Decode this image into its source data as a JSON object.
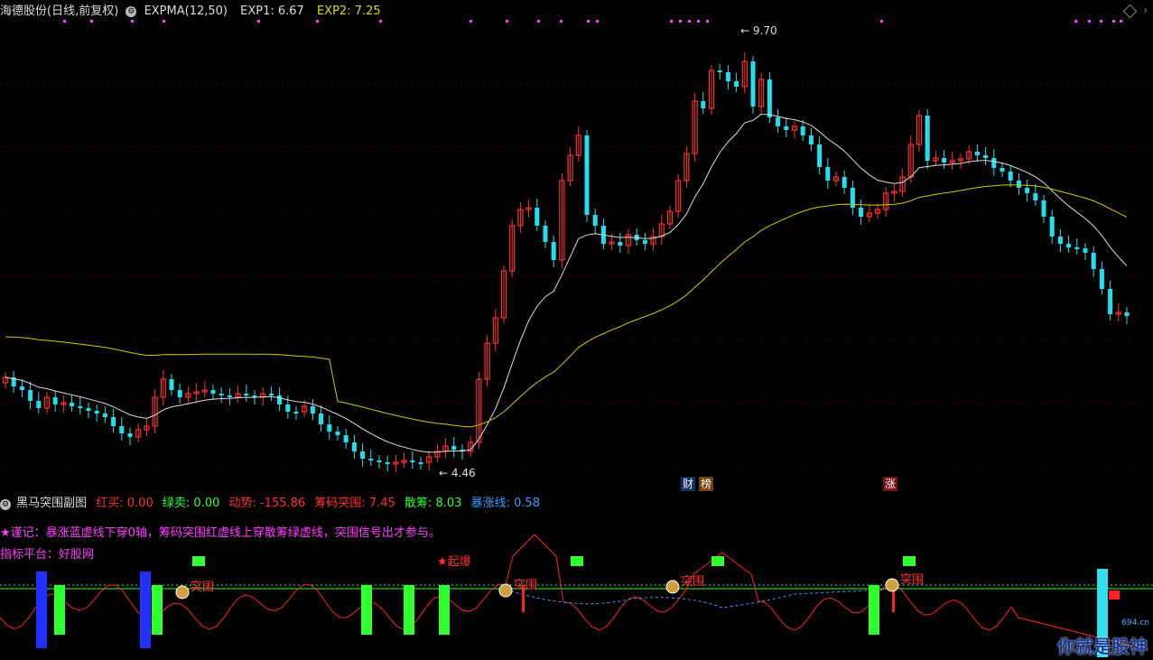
{
  "header": {
    "stock_title": "海德股份(日线,前复权)",
    "indicator": "EXPMA(12,50)",
    "exp1_label": "EXP1: 6.67",
    "exp2_label": "EXP2: 7.25",
    "colors": {
      "exp1": "#dddddd",
      "exp2": "#dddd00",
      "title": "#dddddd"
    }
  },
  "annotations": {
    "high_label": "9.70",
    "low_label": "4.46",
    "tags": [
      "财",
      "榜",
      "涨"
    ]
  },
  "sub_header": {
    "name": "黑马突围副图",
    "items": [
      {
        "text": "红买: 0.00",
        "color": "#ff3030"
      },
      {
        "text": "绿卖: 0.00",
        "color": "#30ff30"
      },
      {
        "text": "动势: -155.86",
        "color": "#ff3030"
      },
      {
        "text": "筹码突围: 7.45",
        "color": "#ff3030"
      },
      {
        "text": "散筹: 8.03",
        "color": "#30ff30"
      },
      {
        "text": "暴涨线: 0.58",
        "color": "#30a0ff"
      }
    ]
  },
  "notes": {
    "warning": "★谨记：暴涨蓝虚线下穿0轴，筹码突围红虚线上穿散筹绿虚线，突围信号出才参与。",
    "platform": "指标平台：好股网",
    "signal_qibao": "★起爆",
    "signal_tuwei": "突围"
  },
  "watermark": {
    "text": "你就是股神",
    "site": "694.cn"
  }
}
